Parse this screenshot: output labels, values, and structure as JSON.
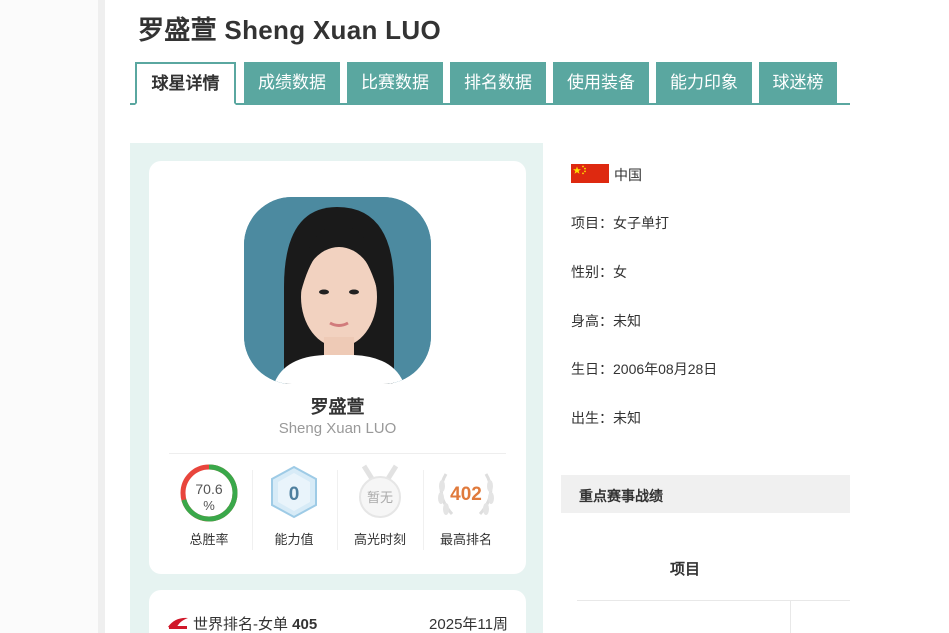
{
  "header": {
    "title": "罗盛萱 Sheng Xuan LUO"
  },
  "tabs": [
    {
      "label": "球星详情",
      "active": true
    },
    {
      "label": "成绩数据"
    },
    {
      "label": "比赛数据"
    },
    {
      "label": "排名数据"
    },
    {
      "label": "使用装备"
    },
    {
      "label": "能力印象"
    },
    {
      "label": "球迷榜"
    }
  ],
  "profile": {
    "name_cn": "罗盛萱",
    "name_en": "Sheng Xuan LUO"
  },
  "stats": [
    {
      "value": "70.6",
      "unit": "%",
      "label": "总胜率",
      "icon": "win-rate-ring-icon",
      "fraction": 0.706
    },
    {
      "value": "0",
      "label": "能力值",
      "icon": "hexagon-badge-icon"
    },
    {
      "value": "暂无",
      "label": "高光时刻",
      "icon": "medal-icon"
    },
    {
      "value": "402",
      "label": "最高排名",
      "icon": "laurel-wreath-icon"
    }
  ],
  "ranking": {
    "label": "世界排名-女单",
    "value": "405",
    "week": "2025年11周",
    "icon": "bwf-logo-icon"
  },
  "info": {
    "country": "中国",
    "event": "项目：女子单打",
    "gender": "性别：女",
    "height": "身高：未知",
    "birthday": "生日：2006年08月28日",
    "birthplace": "出生：未知"
  },
  "key_results": {
    "title": "重点赛事战绩",
    "column_event": "项目"
  },
  "colors": {
    "accent": "#5aa7a0",
    "panel": "#e6f3f1",
    "win_ring_green": "#3aa84a",
    "win_ring_red": "#e8453c",
    "rank_orange": "#e07a3c",
    "flag_red": "#de2910"
  }
}
